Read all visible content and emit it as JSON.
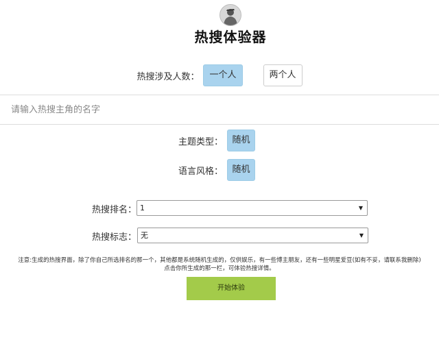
{
  "header": {
    "title": "热搜体验器",
    "avatar_icon": "person-avatar-icon"
  },
  "people": {
    "label": "热搜涉及人数：",
    "options": [
      "一个人",
      "两个人"
    ],
    "selected": "一个人"
  },
  "name_input": {
    "placeholder": "请输入热搜主角的名字",
    "value": ""
  },
  "theme": {
    "label": "主题类型：",
    "value": "随机"
  },
  "style": {
    "label": "语言风格：",
    "value": "随机"
  },
  "rank": {
    "label": "热搜排名：",
    "value": "1"
  },
  "badge": {
    "label": "热搜标志：",
    "value": "无"
  },
  "note": {
    "line1": "注意:生成的热搜界面，除了你自己所选排名的那一个，其他都是系统随机生成的，仅供娱乐，有一些博主朋友，还有一些明星爱豆(如有不妥，请联系我删除)",
    "line2": "点击你所生成的那一栏，可体验热搜详情。"
  },
  "start_button": {
    "label": "开始体验"
  },
  "colors": {
    "selected_pill": "#a9d3ee",
    "start_button": "#a3cb4a"
  }
}
